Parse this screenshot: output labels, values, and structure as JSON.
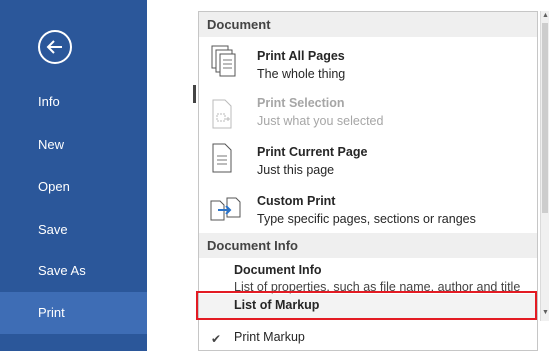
{
  "nav": {
    "items": [
      {
        "label": "Info"
      },
      {
        "label": "New"
      },
      {
        "label": "Open"
      },
      {
        "label": "Save"
      },
      {
        "label": "Save As"
      },
      {
        "label": "Print"
      }
    ],
    "active": "Print",
    "colors": {
      "background": "#2b579a",
      "active": "#3e6db5"
    }
  },
  "menu": {
    "section_document": "Document",
    "options": [
      {
        "title": "Print All Pages",
        "desc": "The whole thing",
        "icon": "all-pages-icon"
      },
      {
        "title": "Print Selection",
        "desc": "Just what you selected",
        "icon": "selection-icon"
      },
      {
        "title": "Print Current Page",
        "desc": "Just this page",
        "icon": "current-page-icon"
      },
      {
        "title": "Custom Print",
        "desc": "Type specific pages, sections or ranges",
        "icon": "custom-print-icon"
      }
    ],
    "section_doc_info": "Document Info",
    "doc_info": {
      "title": "Document Info",
      "desc": "List of properties, such as file name, author and title"
    },
    "list_of_markup": "List of Markup",
    "print_markup": "Print Markup",
    "highlight_color": "#e31b23"
  }
}
